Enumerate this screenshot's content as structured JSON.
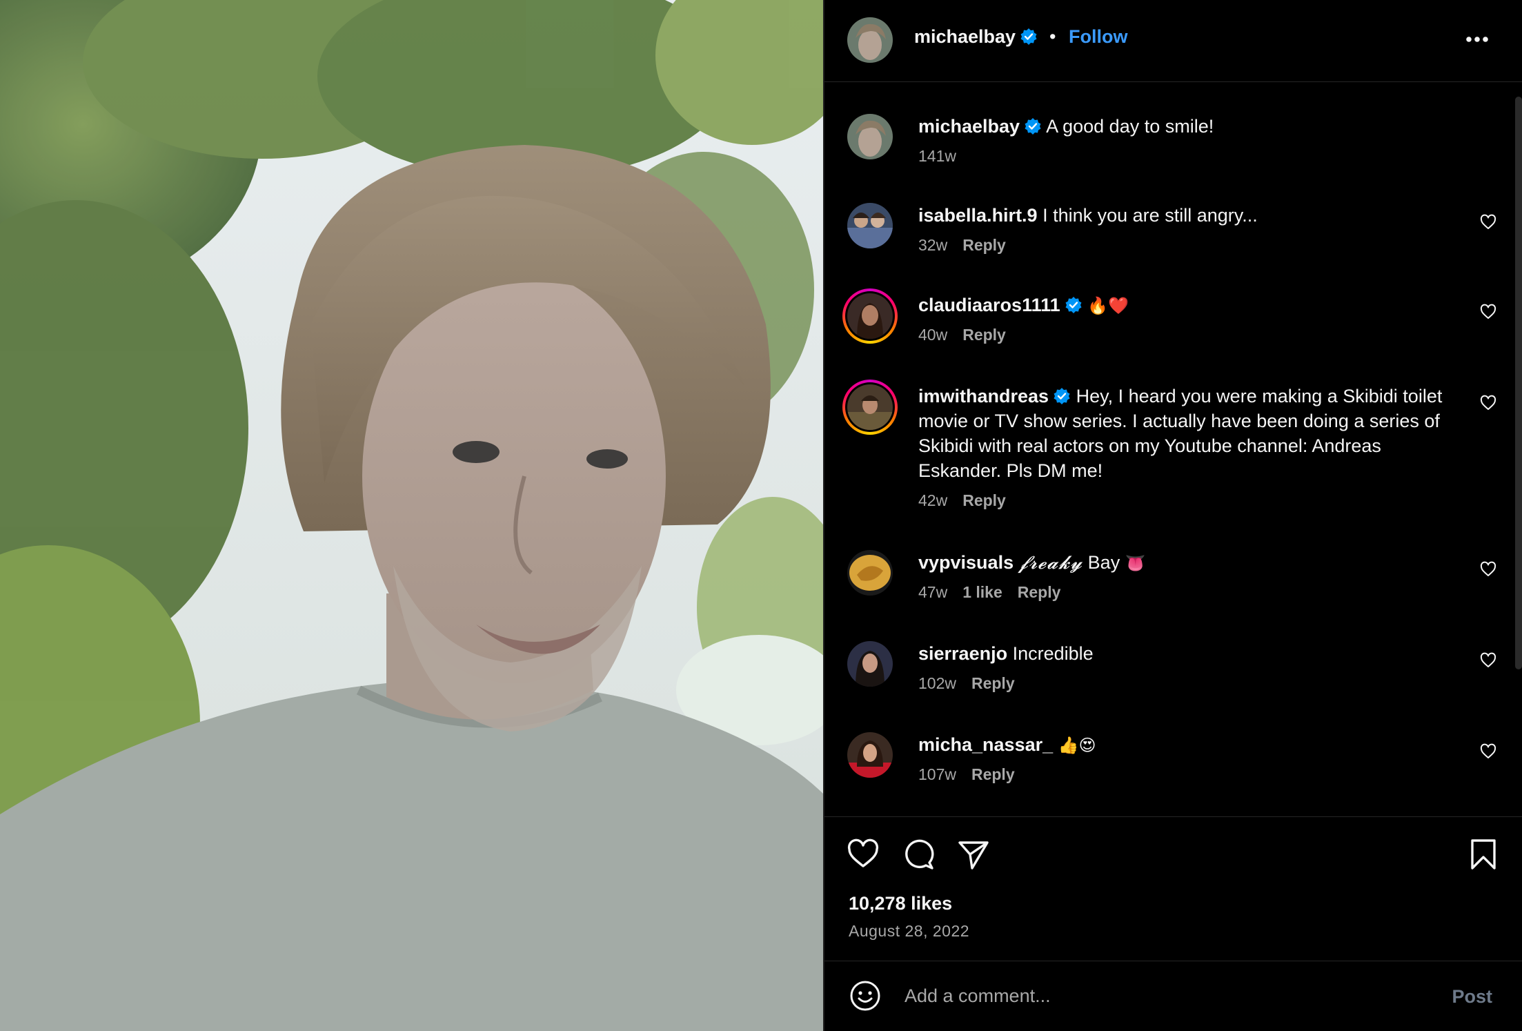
{
  "post": {
    "author": "michaelbay",
    "follow_label": "Follow",
    "separator": "•",
    "photo_icon": "portrait-photo",
    "more_icon": "more-horizontal-icon"
  },
  "caption": {
    "username": "michaelbay",
    "text": "A good day to smile!",
    "time": "141w"
  },
  "comments": [
    {
      "username": "isabella.hirt.9",
      "verified": false,
      "text": "I think you are still angry...",
      "time": "32w",
      "reply": "Reply"
    },
    {
      "username": "claudiaaros1111",
      "verified": true,
      "text": "🔥❤️",
      "time": "40w",
      "reply": "Reply"
    },
    {
      "username": "imwithandreas",
      "verified": true,
      "text": "Hey, I heard you were making a Skibidi toilet movie or TV show series. I actually have been doing a series of Skibidi with real actors on my Youtube channel: Andreas Eskander. Pls DM me!",
      "time": "42w",
      "reply": "Reply"
    },
    {
      "username": "vypvisuals",
      "verified": false,
      "text_styled": "𝓯𝓻𝓮𝓪𝓴𝔂",
      "text": "Bay",
      "text_emoji": "👅",
      "time": "47w",
      "likes": "1 like",
      "reply": "Reply"
    },
    {
      "username": "sierraenjo",
      "verified": false,
      "text": "Incredible",
      "time": "102w",
      "reply": "Reply"
    },
    {
      "username": "micha_nassar_",
      "verified": false,
      "text": "👍😍",
      "time": "107w",
      "reply": "Reply"
    }
  ],
  "footer": {
    "likes": "10,278 likes",
    "date": "August 28, 2022",
    "comment_placeholder": "Add a comment...",
    "post_label": "Post"
  },
  "colors": {
    "background": "#000000",
    "link_blue": "#3b9bff",
    "verified_blue": "#0095f6",
    "muted_text": "#a8a8a8"
  }
}
